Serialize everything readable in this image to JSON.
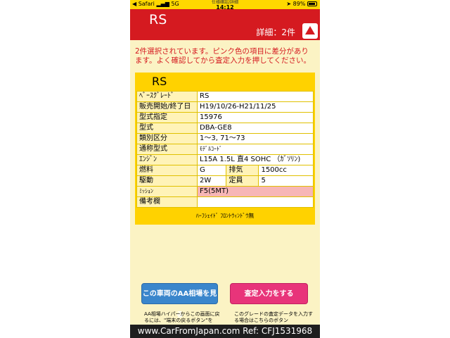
{
  "status_bar": {
    "left": "◀ Safari",
    "signal": "5G",
    "url": "仕様確認/詳細",
    "time": "14:12",
    "battery": "89%"
  },
  "header": {
    "title": "RS",
    "detail": "詳細：2件"
  },
  "notice": "2件選択されています。ピンク色の項目に差分があります。よく確認してから査定入力を押してください。",
  "card": {
    "title": "RS",
    "rows": {
      "base_grade": {
        "label": "ﾍﾞｰｽｸﾞﾚｰﾄﾞ",
        "value": "RS"
      },
      "sales_period": {
        "label": "販売開始/終了日",
        "value": "H19/10/26-H21/11/25"
      },
      "type_designation": {
        "label": "型式指定",
        "value": "15976"
      },
      "model": {
        "label": "型式",
        "value": "DBA-GE8"
      },
      "category": {
        "label": "類別区分",
        "value": "1～3, 71～73"
      },
      "common_model": {
        "label": "通称型式",
        "value": "ﾓﾃﾞﾙｺｰﾄﾞ"
      },
      "engine": {
        "label": "ｴﾝｼﾞﾝ",
        "value": "L15A 1.5L 直4 SOHC （ｶﾞｿﾘﾝ)"
      },
      "fuel": {
        "label": "燃料",
        "value": "G",
        "label2": "排気",
        "value2": "1500cc"
      },
      "drive": {
        "label": "駆動",
        "value": "2W",
        "label2": "定員",
        "value2": "5"
      },
      "mission": {
        "label": "ﾐｯｼｮﾝ",
        "value": "F5(5MT)"
      },
      "remarks": {
        "label": "備考欄",
        "value": ""
      }
    },
    "remarks_text": "ﾊｰﾌｼｪｲﾄﾞ ﾌﾛﾝﾄｳｨﾝﾄﾞｳ無"
  },
  "buttons": {
    "aa_price": "この車両のAA相場を見る",
    "assess": "査定入力をする"
  },
  "notes": {
    "left": "AA相場ハイパーからこの画面に戻るには、\"端末の戻るボタン\"を",
    "right": "このグレードの査定データを入力する場合はこちらのボタン"
  },
  "footer": "www.CarFromJapan.com Ref: CFJ1531968",
  "colors": {
    "header_red": "#d51a20",
    "status_yellow": "#ffd800",
    "card_yellow": "#ffd200",
    "diff_pink": "#f7b6b6",
    "button_blue": "#3a86cc",
    "button_pink": "#e8347a"
  }
}
